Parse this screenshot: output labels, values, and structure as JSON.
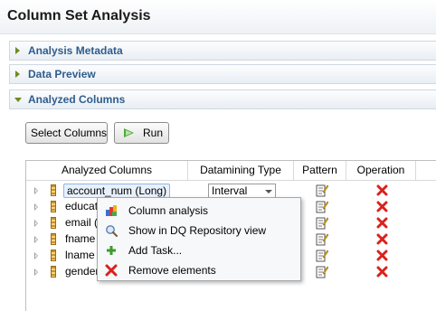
{
  "editor": {
    "title": "Column Set Analysis"
  },
  "sections": [
    {
      "label": "Analysis Metadata",
      "expanded": false
    },
    {
      "label": "Data Preview",
      "expanded": false
    },
    {
      "label": "Analyzed Columns",
      "expanded": true
    }
  ],
  "toolbar": {
    "select_columns_label": "Select Columns",
    "run_label": "Run"
  },
  "table": {
    "headers": [
      "Analyzed Columns",
      "Datamining Type",
      "Pattern",
      "Operation"
    ],
    "rows": [
      {
        "name": "account_num (Long)",
        "datamining_type": "Interval"
      },
      {
        "name": "educat"
      },
      {
        "name": "email ("
      },
      {
        "name": "fname"
      },
      {
        "name": "lname"
      },
      {
        "name": "gender"
      }
    ]
  },
  "context_menu": {
    "items": [
      {
        "label": "Column analysis",
        "icon": "column-analysis-icon"
      },
      {
        "label": "Show in DQ Repository view",
        "icon": "magnifier-icon"
      },
      {
        "label": "Add Task...",
        "icon": "add-plus-icon"
      },
      {
        "label": "Remove elements",
        "icon": "red-x-icon"
      }
    ]
  },
  "colors": {
    "section_title": "#2e5d8c",
    "twisty": "#6f8a20",
    "delete": "#d9221c",
    "run": "#52a93a"
  }
}
